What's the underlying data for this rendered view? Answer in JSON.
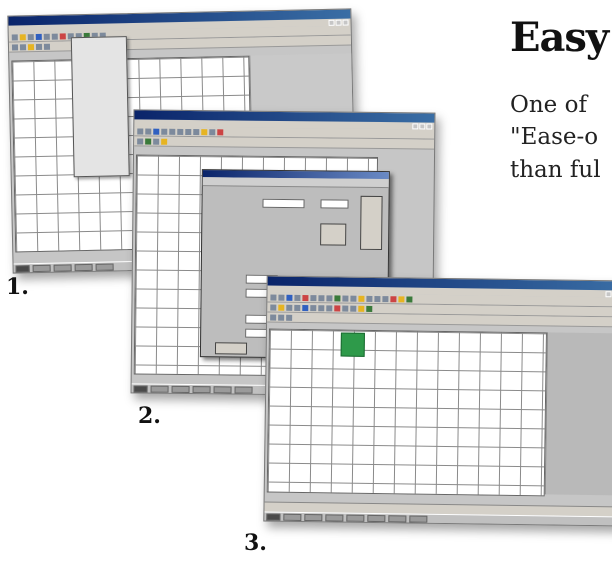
{
  "heading": "Easy",
  "intro_lines": [
    "One of",
    "\"Ease-o",
    "than ful"
  ],
  "step_numbers": [
    "1.",
    "2.",
    "3."
  ],
  "screenshots": [
    {
      "name": "screenshot-1"
    },
    {
      "name": "screenshot-2"
    },
    {
      "name": "screenshot-3"
    }
  ],
  "colors": {
    "title_bar": "#0a246a",
    "grid_line": "#8a8a8a",
    "selected_cell": "#2e9a4a"
  }
}
